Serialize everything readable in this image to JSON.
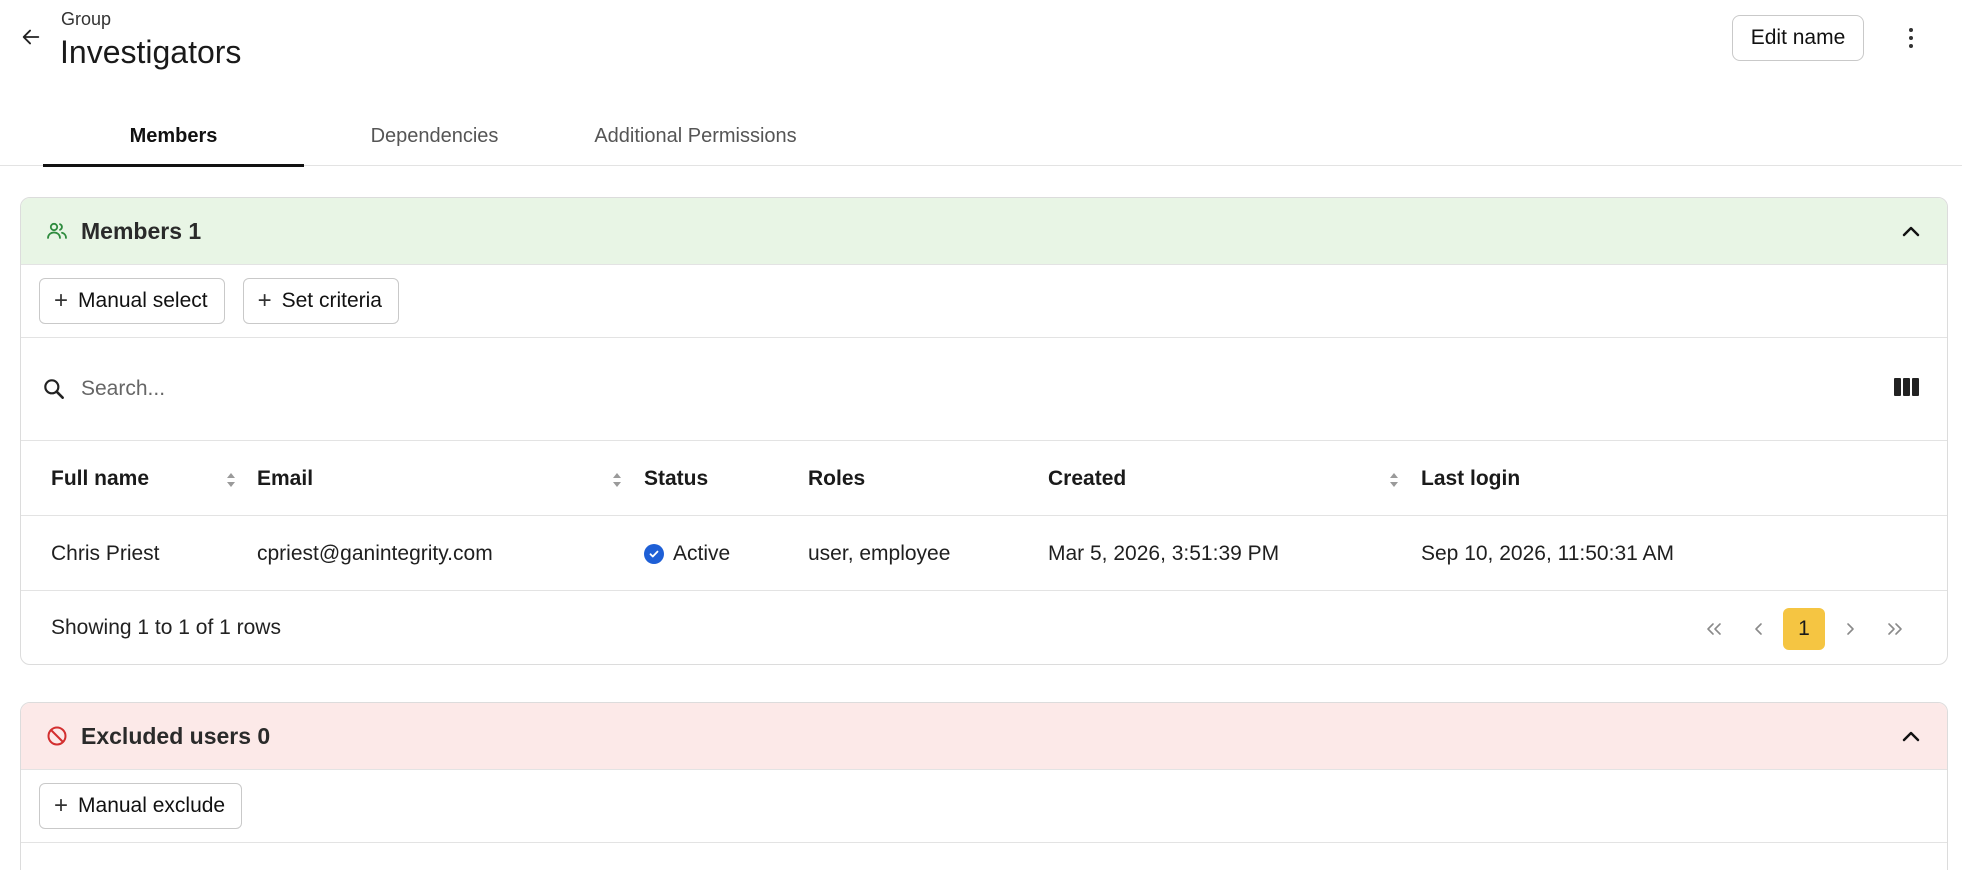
{
  "header": {
    "eyebrow": "Group",
    "title": "Investigators",
    "edit_label": "Edit name"
  },
  "tabs": [
    {
      "label": "Members",
      "active": true
    },
    {
      "label": "Dependencies",
      "active": false
    },
    {
      "label": "Additional Permissions",
      "active": false
    }
  ],
  "members": {
    "title": "Members 1",
    "manual_select": "Manual select",
    "set_criteria": "Set criteria",
    "search_placeholder": "Search...",
    "columns": [
      "Full name",
      "Email",
      "Status",
      "Roles",
      "Created",
      "Last login"
    ],
    "rows": [
      {
        "full_name": "Chris Priest",
        "email": "cpriest@ganintegrity.com",
        "status": "Active",
        "roles": "user, employee",
        "created": "Mar 5, 2026, 3:51:39 PM",
        "last_login": "Sep 10, 2026, 11:50:31 AM"
      }
    ],
    "showing": "Showing 1 to 1 of 1 rows",
    "pager": {
      "first": "<<",
      "prev": "<",
      "page": "1",
      "next": ">",
      "last": ">>"
    }
  },
  "excluded": {
    "title": "Excluded users 0",
    "manual_exclude": "Manual exclude"
  },
  "colors": {
    "members_header_bg": "#e8f5e5",
    "members_icon": "#2e8b3e",
    "excluded_header_bg": "#fce9e8",
    "excluded_icon": "#d32f2f",
    "status_active": "#1e5fd6",
    "page_current": "#f5c542"
  },
  "icons": {
    "back": "arrow-left-icon",
    "more": "more-vertical-icon",
    "members": "users-icon",
    "excluded": "block-icon",
    "collapse": "chevron-up-icon",
    "search": "search-icon",
    "columns": "columns-icon",
    "status": "check-circle-icon"
  }
}
